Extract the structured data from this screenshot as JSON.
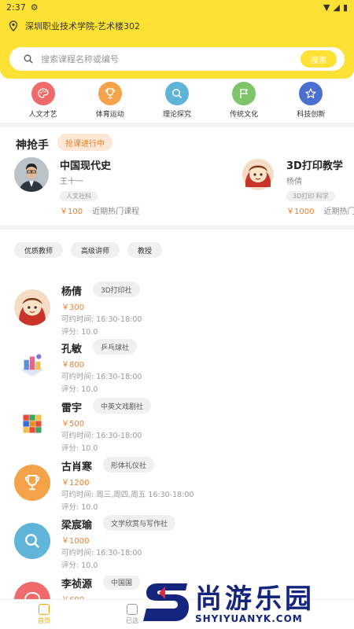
{
  "status_bar": {
    "time": "2:37"
  },
  "location": {
    "text": "深圳职业技术学院-艺术楼302"
  },
  "search": {
    "placeholder": "搜索课程名称或编号",
    "button": "搜索"
  },
  "categories": [
    {
      "label": "人文才艺",
      "color": "#ef6b6b",
      "icon": "palette-icon"
    },
    {
      "label": "体育运动",
      "color": "#f5a34b",
      "icon": "trophy-icon"
    },
    {
      "label": "理论探究",
      "color": "#5fb4d8",
      "icon": "search-icon"
    },
    {
      "label": "传统文化",
      "color": "#7dc46b",
      "icon": "flag-icon"
    },
    {
      "label": "科技创新",
      "color": "#4a6fd0",
      "icon": "star-icon"
    }
  ],
  "flash_sale": {
    "title": "神抢手",
    "badge": "抢课进行中",
    "courses": [
      {
        "title": "中国现代史",
        "teacher": "王十一",
        "tag": "人文社科",
        "price": "￥100",
        "note": "近期热门课程"
      },
      {
        "title": "3D打印教学",
        "teacher": "杨倩",
        "tag": "3D打印 科学",
        "price": "￥1000",
        "note": "近期热门课程"
      }
    ]
  },
  "filters": [
    "优质教师",
    "高级讲师",
    "教授"
  ],
  "teachers": [
    {
      "name": "杨倩",
      "club": "3D打印社",
      "price": "￥300",
      "time": "可约时间:  16:30-18:00",
      "rating": "评分: 10.0",
      "avatar": "cartoon-avatar"
    },
    {
      "name": "孔敏",
      "club": "乒乓球社",
      "price": "￥800",
      "time": "可约时间:  16:30-18:00",
      "rating": "评分: 10.0",
      "avatar": "isometric-avatar"
    },
    {
      "name": "雷宇",
      "club": "中英文戏剧社",
      "price": "￥500",
      "time": "可约时间:  16:30-18:00",
      "rating": "评分: 10.0",
      "avatar": "rubik-cube-avatar"
    },
    {
      "name": "古肖寒",
      "club": "形体礼仪社",
      "price": "￥1200",
      "time": "可约时间: 周三,周四,周五 16:30-18:00",
      "rating": "评分: 10.0",
      "avatar": "trophy-icon"
    },
    {
      "name": "梁宸瑜",
      "club": "文学欣赏与写作社",
      "price": "￥1000",
      "time": "可约时间:  16:30-18:00",
      "rating": "评分: 10.0",
      "avatar": "search-icon"
    },
    {
      "name": "李祯源",
      "club": "中国国",
      "price": "￥600",
      "time": "",
      "rating": "",
      "avatar": "palette-icon"
    }
  ],
  "bottom_nav": [
    {
      "label": "首页",
      "active": true
    },
    {
      "label": "已选",
      "active": false
    }
  ],
  "watermark": {
    "text": "尚游乐园",
    "url": "SHYIYUANYK.COM"
  }
}
